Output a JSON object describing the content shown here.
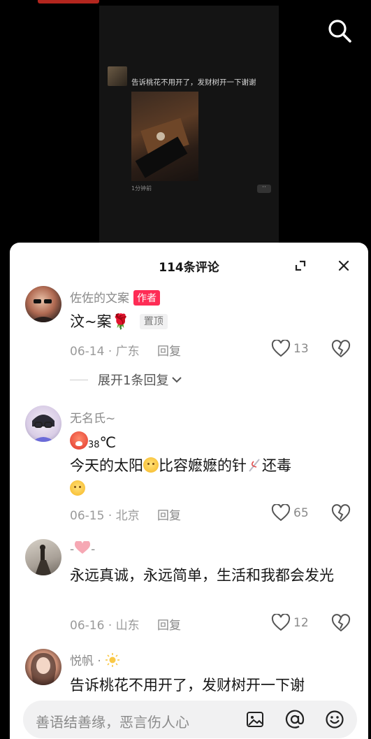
{
  "post": {
    "caption": "告诉桃花不用开了，发财树开一下谢谢",
    "time": "1分钟前"
  },
  "sheet": {
    "title": "114条评论"
  },
  "comments": [
    {
      "username": "佐佐的文案",
      "author_tag": "作者",
      "text": "汶~案🌹",
      "pin_tag": "置顶",
      "date": "06-14",
      "location": "广东",
      "reply": "回复",
      "likes": "13",
      "expand_replies": "展开1条回复"
    },
    {
      "username": "无名氏~",
      "temp": "38",
      "temp_unit": "℃",
      "text_part1": "今天的太阳",
      "text_part2": "比容嬷嬷的针",
      "text_part3": "还毒",
      "date": "06-15",
      "location": "北京",
      "reply": "回复",
      "likes": "65"
    },
    {
      "username_left": "-",
      "username_right": "-",
      "text": "永远真诚，永远简单，生活和我都会发光",
      "date": "06-16",
      "location": "山东",
      "reply": "回复",
      "likes": "12"
    },
    {
      "username": "悦帆",
      "text": "告诉桃花不用开了，发财树开一下谢"
    }
  ],
  "input": {
    "placeholder": "善语结善缘，恶言伤人心"
  },
  "meta_sep": "·",
  "colors": {
    "accent": "#fe2c55",
    "sheet_bg": "#ffffff",
    "secondary_text": "#8a8a8a"
  }
}
